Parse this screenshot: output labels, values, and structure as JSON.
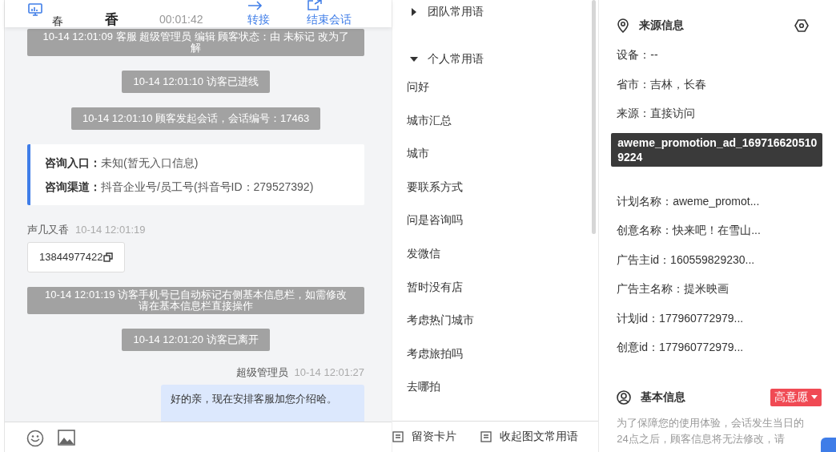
{
  "chat_header": {
    "location_lines": [
      "春"
    ],
    "visitor_name_lines": [
      "香"
    ],
    "duration": "00:01:42",
    "actions": [
      {
        "label": "转接",
        "kind": "transfer"
      },
      {
        "label": "结束会话",
        "kind": "end"
      }
    ]
  },
  "messages": [
    {
      "kind": "system",
      "text": "10-14 12:01:09 客服 超级管理员 编辑 顾客状态：由 未标记 改为了解",
      "wide": true
    },
    {
      "kind": "system",
      "text": "10-14 12:01:10 访客已进线",
      "wide": false
    },
    {
      "kind": "system",
      "text": "10-14 12:01:10 顾客发起会话，会话编号：17463",
      "wide": false
    },
    {
      "kind": "entry_card",
      "rows": [
        {
          "label": "咨询入口：",
          "value": "未知(暂无入口信息)"
        },
        {
          "label": "咨询渠道：",
          "value": "抖音企业号/员工号(抖音号ID：279527392)"
        }
      ]
    },
    {
      "kind": "visitor",
      "sender": "声几又香",
      "time": "10-14 12:01:19",
      "text": "13844977422"
    },
    {
      "kind": "system",
      "text": "10-14 12:01:19 访客手机号已自动标记右侧基本信息栏，如需修改请在基本信息栏直接操作",
      "wide": true
    },
    {
      "kind": "system",
      "text": "10-14 12:01:20 访客已离开",
      "wide": false
    },
    {
      "kind": "agent",
      "sender": "超级管理员",
      "time": "10-14 12:01:27",
      "text": "好的亲，现在安排客服加您介绍哈。"
    }
  ],
  "phrases": {
    "groups": [
      {
        "label": "团队常用语",
        "expanded": false
      },
      {
        "label": "个人常用语",
        "expanded": true,
        "children": [
          {
            "label": "问好"
          },
          {
            "label": "城市汇总"
          },
          {
            "label": "城市"
          },
          {
            "label": "要联系方式"
          },
          {
            "label": "问是咨询吗"
          },
          {
            "label": "发微信"
          },
          {
            "label": "暂时没有店"
          },
          {
            "label": "考虑热门城市"
          },
          {
            "label": "考虑旅拍吗"
          },
          {
            "label": "去哪拍"
          }
        ]
      }
    ],
    "footer": [
      "留资卡片",
      "收起图文常用语"
    ]
  },
  "source_info": {
    "title": "来源信息",
    "fields": [
      {
        "kind": "field",
        "text": "设备：--"
      },
      {
        "kind": "field",
        "text": "省市：吉林，长春"
      },
      {
        "kind": "field",
        "text": "来源：直接访问"
      },
      {
        "kind": "tooltip",
        "text": "aweme_promotion_ad_1697166205109224"
      },
      {
        "kind": "field",
        "text": "计划名称：aweme_promot..."
      },
      {
        "kind": "field",
        "text": "创意名称：快来吧！在雪山..."
      },
      {
        "kind": "field",
        "text": "广告主id：160559829230..."
      },
      {
        "kind": "field",
        "text": "广告主名称：提米映画"
      },
      {
        "kind": "field",
        "text": "计划id：177960772979..."
      },
      {
        "kind": "field",
        "text": "创意id：177960772979..."
      }
    ]
  },
  "basic_info": {
    "title": "基本信息",
    "intent_tag": "高意愿",
    "note": "为了保障您的使用体验，会话发生当日的24点之后，顾客信息将无法修改，请"
  }
}
